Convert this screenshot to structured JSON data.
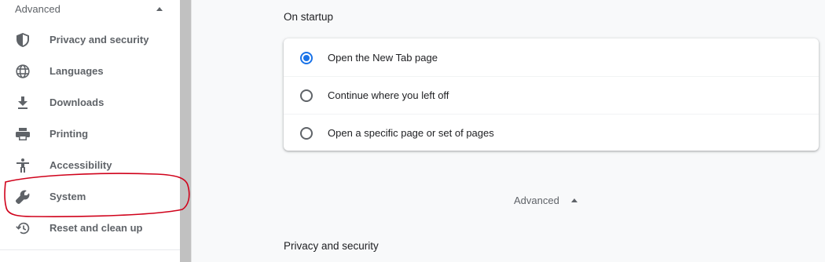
{
  "sidebar": {
    "header": {
      "label": "Advanced",
      "icon": "caret-up-icon"
    },
    "items": [
      {
        "label": "Privacy and security",
        "icon": "shield-icon"
      },
      {
        "label": "Languages",
        "icon": "globe-icon"
      },
      {
        "label": "Downloads",
        "icon": "download-icon"
      },
      {
        "label": "Printing",
        "icon": "printer-icon"
      },
      {
        "label": "Accessibility",
        "icon": "accessibility-icon"
      },
      {
        "label": "System",
        "icon": "wrench-icon",
        "annotated": true
      },
      {
        "label": "Reset and clean up",
        "icon": "history-icon"
      }
    ]
  },
  "main": {
    "startup": {
      "title": "On startup",
      "options": [
        {
          "label": "Open the New Tab page",
          "checked": true
        },
        {
          "label": "Continue where you left off",
          "checked": false
        },
        {
          "label": "Open a specific page or set of pages",
          "checked": false
        }
      ]
    },
    "advanced": {
      "label": "Advanced"
    },
    "privacy": {
      "title": "Privacy and security"
    }
  },
  "colors": {
    "accent": "#1a73e8",
    "annotation": "#d0021b",
    "sidebar_text": "#5f6368"
  }
}
